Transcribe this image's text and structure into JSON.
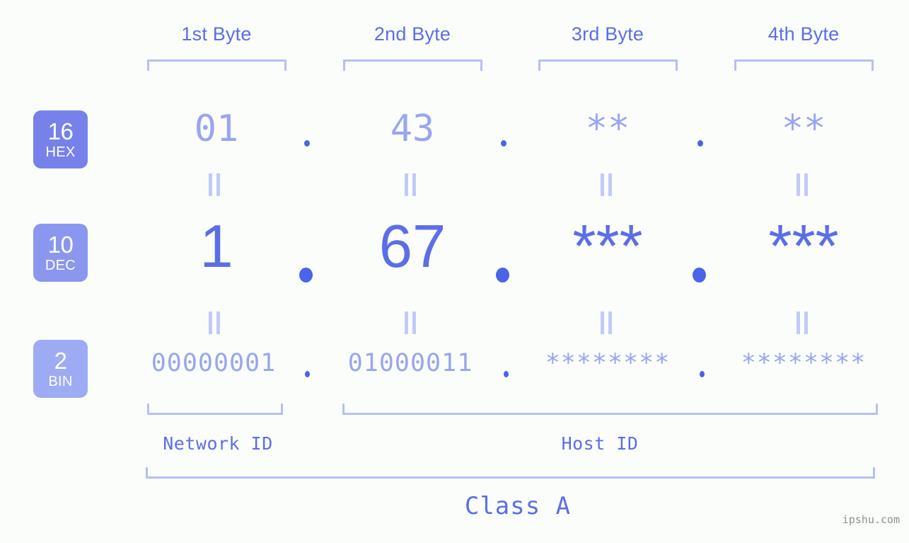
{
  "background_color": "#fbfdfa",
  "accent_color": "#5b6ee8",
  "muted_accent_color": "#98a6f0",
  "bracket_color": "#b6c0f5",
  "header": {
    "byte_labels": [
      {
        "label": "1st Byte"
      },
      {
        "label": "2nd Byte"
      },
      {
        "label": "3rd Byte"
      },
      {
        "label": "4th Byte"
      }
    ]
  },
  "rows": [
    {
      "badge_number": "16",
      "badge_name": "HEX",
      "badge_color": "#7682ea",
      "values": [
        "01",
        "43",
        "**",
        "**"
      ],
      "separator": "."
    },
    {
      "badge_number": "10",
      "badge_name": "DEC",
      "badge_color": "#8b97ef",
      "values": [
        "1",
        "67",
        "***",
        "***"
      ],
      "separator": "."
    },
    {
      "badge_number": "2",
      "badge_name": "BIN",
      "badge_color": "#9dabf4",
      "values": [
        "00000001",
        "01000011",
        "********",
        "********"
      ],
      "separator": "."
    }
  ],
  "equals_separator": "=",
  "footer": {
    "network_id_label": "Network ID",
    "host_id_label": "Host ID",
    "class_label": "Class A"
  },
  "watermark": "ipshu.com"
}
